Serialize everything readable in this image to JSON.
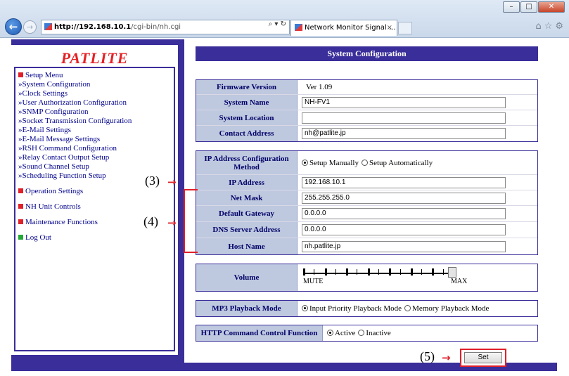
{
  "browser": {
    "url_host": "http://192.168.10.1",
    "url_path": "/cgi-bin/nh.cgi",
    "address_controls": "⌕ ▾ ↻",
    "tab_title": "Network Monitor Signal ...",
    "tab_close": "×",
    "window_buttons": [
      "–",
      "□",
      "✕"
    ],
    "tools": [
      "⌂",
      "☆",
      "⚙"
    ]
  },
  "sidebar": {
    "logo": "PATLITE",
    "setup_menu": "Setup Menu",
    "setup_items": [
      "»System Configuration",
      "»Clock Settings",
      "»User Authorization Configuration",
      "»SNMP Configuration",
      "»Socket Transmission Configuration",
      "»E-Mail Settings",
      "»E-Mail Message Settings",
      "»RSH Command Configuration",
      "»Relay Contact Output Setup",
      "»Sound Channel Setup",
      "»Scheduling Function Setup"
    ],
    "sections": [
      "Operation Settings",
      "NH Unit Controls",
      "Maintenance Functions",
      "Log Out"
    ]
  },
  "main": {
    "title": "System Configuration",
    "system": [
      {
        "label": "Firmware Version",
        "value": "Ver 1.09"
      },
      {
        "label": "System Name",
        "value": "NH-FV1"
      },
      {
        "label": "System Location",
        "value": ""
      },
      {
        "label": "Contact Address",
        "value": "nh@patlite.jp"
      }
    ],
    "network": {
      "method_label": "IP Address Configuration Method",
      "method_options": [
        "Setup Manually",
        "Setup Automatically"
      ],
      "method_selected": "Setup Manually",
      "fields": [
        {
          "label": "IP Address",
          "value": "192.168.10.1"
        },
        {
          "label": "Net Mask",
          "value": "255.255.255.0"
        },
        {
          "label": "Default Gateway",
          "value": "0.0.0.0"
        },
        {
          "label": "DNS Server Address",
          "value": "0.0.0.0"
        },
        {
          "label": "Host Name",
          "value": "nh.patlite.jp"
        }
      ]
    },
    "volume": {
      "label": "Volume",
      "min_label": "MUTE",
      "max_label": "MAX",
      "level": 1.0
    },
    "mp3": {
      "label": "MP3 Playback Mode",
      "options": [
        "Input Priority Playback Mode",
        "Memory Playback Mode"
      ],
      "selected": "Input Priority Playback Mode"
    },
    "http": {
      "label": "HTTP Command Control Function",
      "options": [
        "Active",
        "Inactive"
      ],
      "selected": "Active"
    },
    "set_button": "Set"
  },
  "annotations": {
    "a3": "(3)",
    "a4": "(4)",
    "a5": "(5)",
    "arrow": "→"
  },
  "colors": {
    "header_bg": "#3a2e9a",
    "label_bg": "#bec8df",
    "annotation_red": "#e0202a",
    "logo_red": "#e32226"
  }
}
